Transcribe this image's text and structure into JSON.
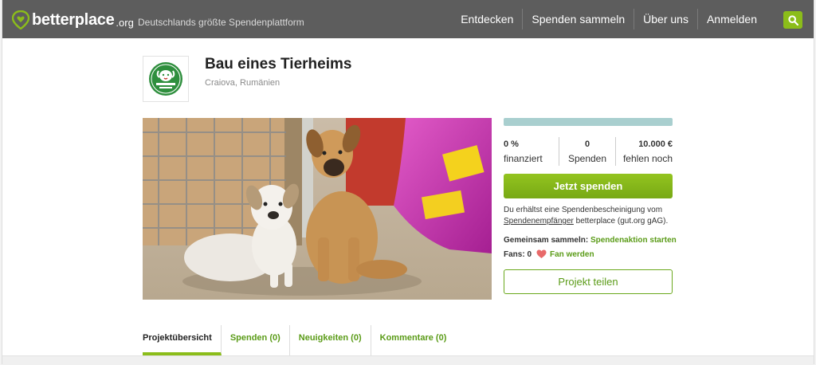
{
  "header": {
    "logo_text": "betterplace",
    "logo_suffix": ".org",
    "tagline": "Deutschlands größte Spendenplattform",
    "nav": [
      "Entdecken",
      "Spenden sammeln",
      "Über uns",
      "Anmelden"
    ],
    "search_icon": "search-icon",
    "brand_color": "#8bbd1a"
  },
  "project": {
    "title": "Bau eines Tierheims",
    "location": "Craiova, Rumänien",
    "logo_icon": "animal-shelter-logo"
  },
  "funding": {
    "progress_fraction": 0,
    "percent": "0 %",
    "percent_label": "finanziert",
    "donations": "0",
    "donations_label": "Spenden",
    "missing": "10.000 €",
    "missing_label": "fehlen noch"
  },
  "actions": {
    "donate": "Jetzt spenden",
    "receipt_text": "Du erhältst eine Spendenbescheinigung vom",
    "receipt_link": "Spendenempfänger",
    "receipt_rest": "betterplace (gut.org gAG).",
    "collect_label": "Gemeinsam sammeln:",
    "collect_link": "Spendenaktion starten",
    "fans_label": "Fans: 0",
    "fan_link": "Fan werden",
    "share": "Projekt teilen"
  },
  "tabs": [
    "Projektübersicht",
    "Spenden (0)",
    "Neuigkeiten (0)",
    "Kommentare (0)"
  ]
}
